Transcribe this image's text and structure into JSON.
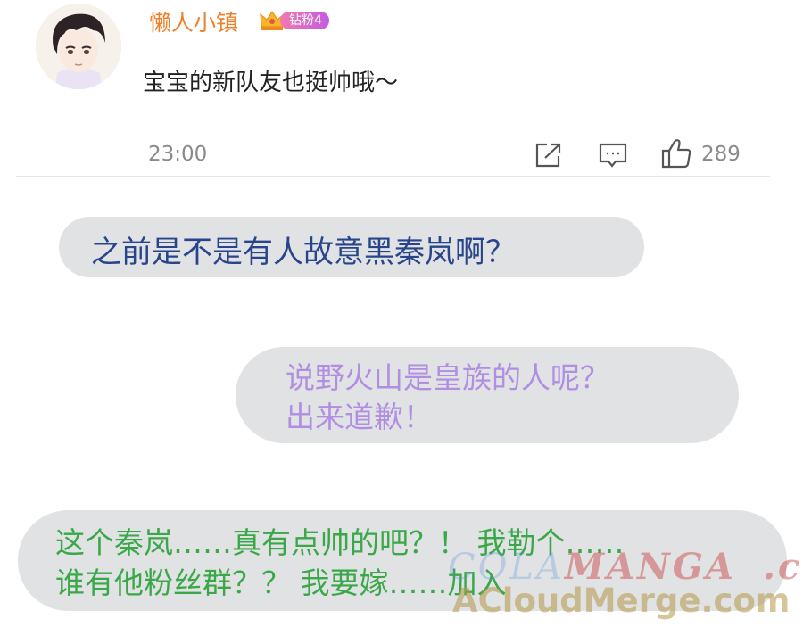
{
  "comment": {
    "username": "懒人小镇",
    "badge": "钻粉4",
    "text": "宝宝的新队友也挺帅哦～",
    "time": "23:00",
    "like_count": "289"
  },
  "chat": [
    {
      "lines": [
        "之前是不是有人故意黑秦岚啊？"
      ]
    },
    {
      "lines": [
        "说野火山是皇族的人呢？",
        "出来道歉！"
      ]
    },
    {
      "lines": [
        "这个秦岚……真有点帅的吧？！ 我勒个……",
        "谁有他粉丝群？？ 我要嫁……加入"
      ]
    }
  ],
  "watermark": {
    "line1_a": "COLA",
    "line1_b": "MANGA",
    "line1_c": ".com",
    "line2": "ACloudMerge.com"
  },
  "colors": {
    "username": "#f07f2a",
    "bubble_bg": "#e1e2e4",
    "text_blue": "#28458c",
    "text_purple": "#b08fe2",
    "text_green": "#3aa848"
  },
  "icons": [
    "avatar",
    "crown-icon",
    "share-icon",
    "reply-icon",
    "like-icon"
  ]
}
